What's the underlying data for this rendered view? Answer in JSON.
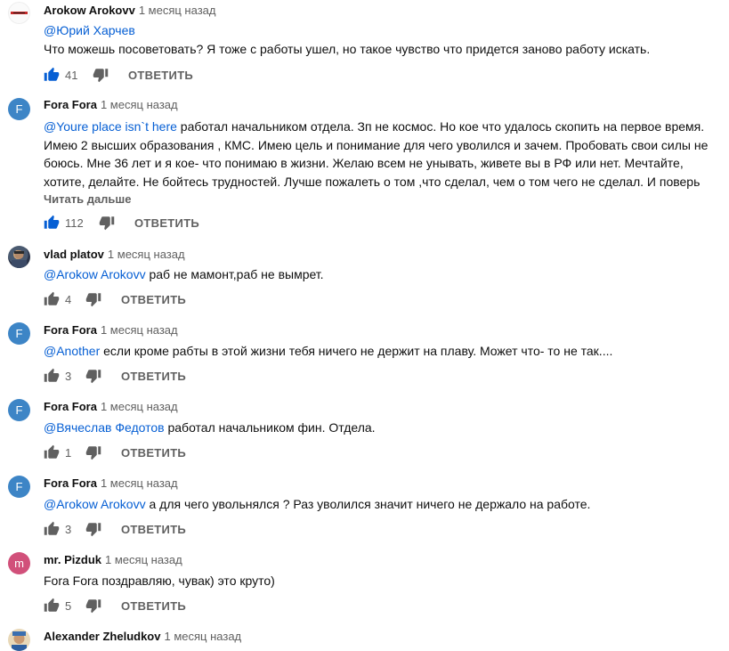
{
  "colors": {
    "link": "#065fd4",
    "secondary_text": "#606060",
    "like_active": "#065fd4",
    "icon_gray": "#606060"
  },
  "actions": {
    "reply_label": "ОТВЕТИТЬ",
    "read_more_label": "Читать дальше"
  },
  "comments": [
    {
      "author": "Arokow Arokovv",
      "time": "1 месяц назад",
      "avatar": {
        "type": "logo-icon"
      },
      "mention": "@Юрий Харчев",
      "text": "Что можешь посоветовать? Я тоже с работы ушел, но такое чувство что придется заново работу искать.",
      "likes": "41",
      "liked": true
    },
    {
      "author": "Fora Fora",
      "time": "1 месяц назад",
      "avatar": {
        "letter": "F",
        "color": "#3d85c6"
      },
      "mention": "@Youre place isn`t here",
      "text": " работал начальником отдела. Зп не космос. Но кое что удалось скопить на первое время. Имею 2 высших образования , КМС. Имею цель и понимание для чего уволился и зачем. Пробовать свои силы не боюсь. Мне 36 лет и я кое- что понимаю в жизни.  Желаю всем не унывать, живете вы в РФ или нет. Мечтайте, хотите, делайте. Не бойтесь трудностей. Лучше пожалеть о том ,что сделал, чем о том чего не сделал. И поверь",
      "likes": "112",
      "liked": true
    },
    {
      "author": "vlad platov",
      "time": "1 месяц назад",
      "avatar": {
        "type": "photo"
      },
      "mention": "@Arokow Arokovv",
      "text": " раб не мамонт,раб не вымрет.",
      "likes": "4",
      "liked": false
    },
    {
      "author": "Fora Fora",
      "time": "1 месяц назад",
      "avatar": {
        "letter": "F",
        "color": "#3d85c6"
      },
      "mention": "@Another",
      "text": " если кроме рабты в этой жизни тебя ничего не держит на плаву. Может что- то не так....",
      "likes": "3",
      "liked": false
    },
    {
      "author": "Fora Fora",
      "time": "1 месяц назад",
      "avatar": {
        "letter": "F",
        "color": "#3d85c6"
      },
      "mention": "@Вячеслав Федотов",
      "text": " работал начальником фин. Отдела.",
      "likes": "1",
      "liked": false
    },
    {
      "author": "Fora Fora",
      "time": "1 месяц назад",
      "avatar": {
        "letter": "F",
        "color": "#3d85c6"
      },
      "mention": "@Arokow Arokovv",
      "text": " а для чего увольнялся ? Раз уволился значит ничего не держало на работе.",
      "likes": "3",
      "liked": false
    },
    {
      "author": "mr. Pizduk",
      "time": "1 месяц назад",
      "avatar": {
        "letter": "m",
        "color": "#d1507a"
      },
      "mention": "",
      "text": "Fora Fora поздравляю, чувак) это круто)",
      "likes": "5",
      "liked": false
    },
    {
      "author": "Alexander Zheludkov",
      "time": "1 месяц назад",
      "avatar": {
        "type": "photo"
      },
      "mention": "",
      "text": "",
      "likes": "",
      "liked": false
    }
  ]
}
